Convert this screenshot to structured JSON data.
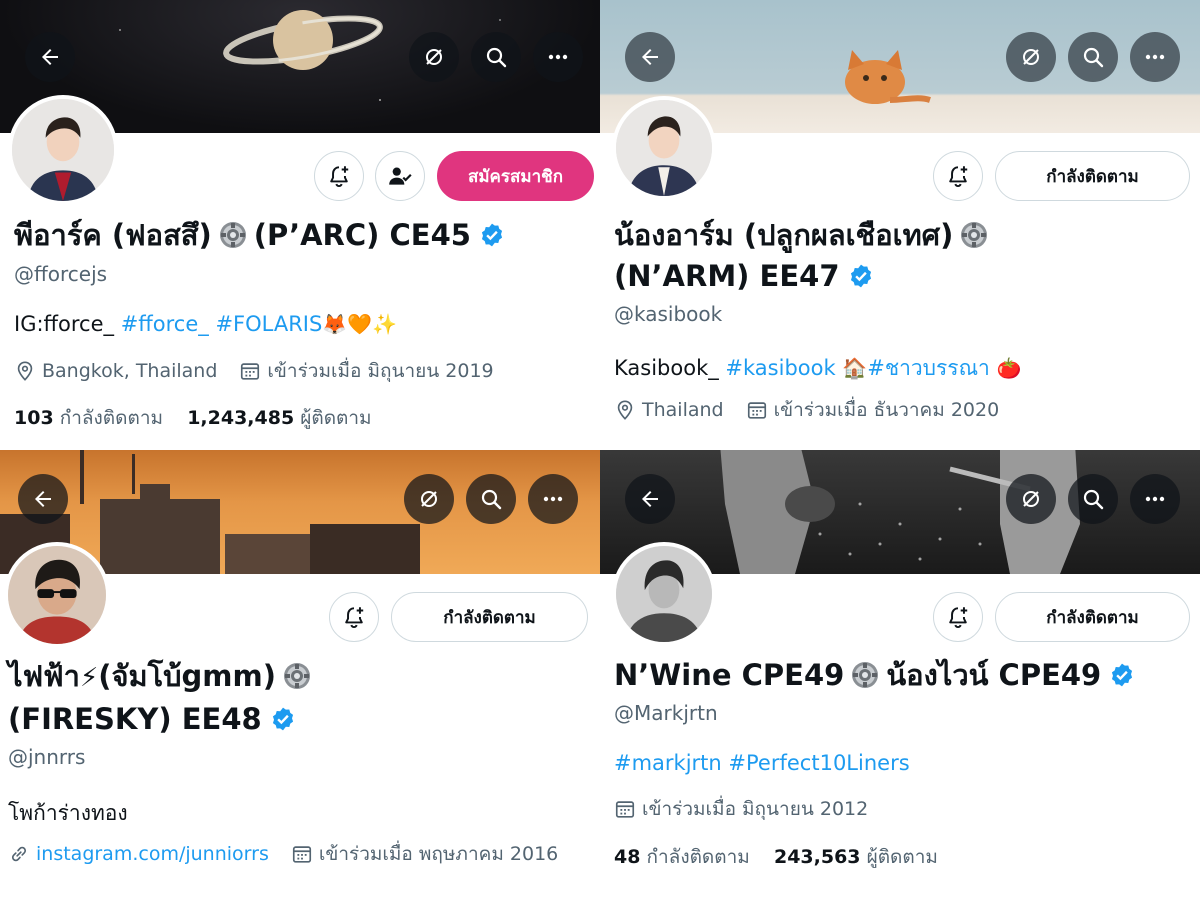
{
  "panels": [
    {
      "action_label": "สมัครสมาชิก",
      "name_part1": "พีอาร์ค (ฟอสสึ)",
      "name_part2": "(P’ARC) CE45",
      "handle": "@fforcejs",
      "bio_text": "IG:fforce_",
      "bio_links": [
        "#fforce_",
        "#FOLARIS"
      ],
      "bio_emojis": "🦊🧡✨",
      "location": "Bangkok, Thailand",
      "joined": "เข้าร่วมเมื่อ มิถุนายน 2019",
      "following_count": "103",
      "following_label": "กำลังติดตาม",
      "followers_count": "1,243,485",
      "followers_label": "ผู้ติดตาม"
    },
    {
      "action_label": "กำลังติดตาม",
      "name_line1": "น้องอาร์ม (ปลูกผลเชือเทศ)",
      "name_line2": "(N’ARM) EE47",
      "handle": "@kasibook",
      "bio_text": "Kasibook_",
      "bio_link1": "#kasibook",
      "bio_emoji1": "🏠",
      "bio_link2": "#ชาวบรรณา",
      "bio_emoji2": "🍅",
      "location": "Thailand",
      "joined": "เข้าร่วมเมื่อ ธันวาคม 2020"
    },
    {
      "action_label": "กำลังติดตาม",
      "name_line1a": "ไฟฟ้า",
      "name_emoji": "⚡",
      "name_line1b": "(จัมโบ้gmm)",
      "name_line2": "(FIRESKY) EE48",
      "handle": "@jnnrrs",
      "bio_text": "โพก้าร่างทอง",
      "website": "instagram.com/junniorrs",
      "joined": "เข้าร่วมเมื่อ พฤษภาคม 2016"
    },
    {
      "action_label": "กำลังติดตาม",
      "name_part1": "N’Wine CPE49",
      "name_part2": "น้องไวน์ CPE49",
      "handle": "@Markjrtn",
      "bio_link1": "#markjrtn",
      "bio_link2": "#Perfect10Liners",
      "joined": "เข้าร่วมเมื่อ มิถุนายน 2012",
      "following_count": "48",
      "following_label": "กำลังติดตาม",
      "followers_count": "243,563",
      "followers_label": "ผู้ติดตาม"
    }
  ],
  "icons": {
    "back": "back-arrow-icon",
    "grok": "grok-icon",
    "search": "search-icon",
    "more": "more-icon",
    "notify": "bell-plus-icon",
    "following": "person-check-icon",
    "verified": "verified-badge-icon",
    "gear": "gear-emoji-icon",
    "location": "location-pin-icon",
    "calendar": "calendar-icon",
    "link": "link-icon"
  },
  "colors": {
    "link": "#1d9bf0",
    "verified": "#1d9bf0",
    "subscribe": "#e0357f",
    "muted": "#536471"
  }
}
